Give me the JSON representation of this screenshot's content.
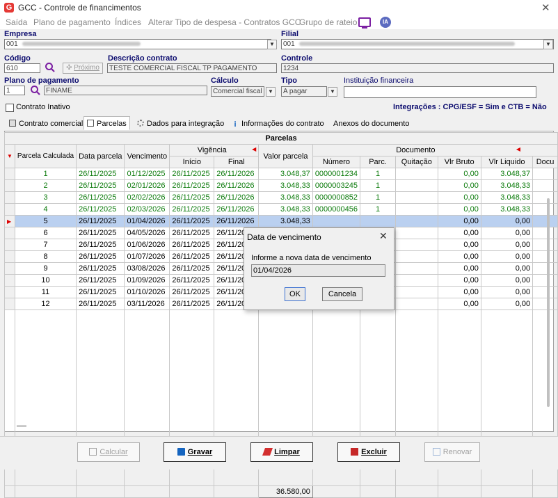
{
  "window": {
    "title": "GCC - Controle de financimentos",
    "close_label": "✕",
    "logo_letter": "G"
  },
  "menu": {
    "items": [
      "Saída",
      "Plano de pagamento",
      "Índices",
      "Alterar Tipo de despesa - Contratos GCC",
      "Grupo de rateio"
    ],
    "ia_label": "IA"
  },
  "form": {
    "empresa": {
      "label": "Empresa",
      "value": "001"
    },
    "filial": {
      "label": "Filial",
      "value": "001"
    },
    "codigo": {
      "label": "Código",
      "value": "610"
    },
    "proximo_label": "Próximo",
    "descricao": {
      "label": "Descrição contrato",
      "value": "TESTE COMERCIAL FISCAL TP PAGAMENTO"
    },
    "controle": {
      "label": "Controle",
      "value": "1234"
    },
    "plano": {
      "label": "Plano de pagamento",
      "code": "1",
      "name": "FINAME"
    },
    "calculo": {
      "label": "Cálculo",
      "value": "Comercial fiscal"
    },
    "tipo": {
      "label": "Tipo",
      "value": "A pagar"
    },
    "instituicao": {
      "label": "Instituição financeira",
      "value": ""
    },
    "inativo_label": "Contrato Inativo",
    "integracoes": "Integrações : CPG/ESF = Sim e CTB = Não"
  },
  "tabs": [
    "Contrato comercial",
    "Parcelas",
    "Dados para integração",
    "Informações do contrato",
    "Anexos do documento"
  ],
  "grid": {
    "caption": "Parcelas",
    "headers": {
      "parcela": "Parcela Calculada",
      "data_parcela": "Data parcela",
      "vencimento": "Vencimento",
      "vigencia": "Vigência",
      "inicio": "Início",
      "final": "Final",
      "valor": "Valor parcela",
      "documento": "Documento",
      "numero": "Número",
      "parc": "Parc.",
      "quitacao": "Quitação",
      "vlr_bruto": "Vlr Bruto",
      "vlr_liquido": "Vlr Liquido",
      "docu": "Docu"
    },
    "rows": [
      {
        "p": "1",
        "dp": "26/11/2025",
        "v": "01/12/2025",
        "i": "26/11/2025",
        "f": "26/11/2026",
        "val": "3.048,37",
        "num": "0000001234",
        "parc": "1",
        "q": "",
        "vb": "0,00",
        "vl": "3.048,37"
      },
      {
        "p": "2",
        "dp": "26/11/2025",
        "v": "02/01/2026",
        "i": "26/11/2025",
        "f": "26/11/2026",
        "val": "3.048,33",
        "num": "0000003245",
        "parc": "1",
        "q": "",
        "vb": "0,00",
        "vl": "3.048,33"
      },
      {
        "p": "3",
        "dp": "26/11/2025",
        "v": "02/02/2026",
        "i": "26/11/2025",
        "f": "26/11/2026",
        "val": "3.048,33",
        "num": "0000000852",
        "parc": "1",
        "q": "",
        "vb": "0,00",
        "vl": "3.048,33"
      },
      {
        "p": "4",
        "dp": "26/11/2025",
        "v": "02/03/2026",
        "i": "26/11/2025",
        "f": "26/11/2026",
        "val": "3.048,33",
        "num": "0000000456",
        "parc": "1",
        "q": "",
        "vb": "0,00",
        "vl": "3.048,33"
      },
      {
        "p": "5",
        "dp": "26/11/2025",
        "v": "01/04/2026",
        "i": "26/11/2025",
        "f": "26/11/2026",
        "val": "3.048,33",
        "num": "",
        "parc": "",
        "q": "",
        "vb": "0,00",
        "vl": "0,00"
      },
      {
        "p": "6",
        "dp": "26/11/2025",
        "v": "04/05/2026",
        "i": "26/11/2025",
        "f": "26/11/2026",
        "val": "",
        "num": "",
        "parc": "",
        "q": "",
        "vb": "0,00",
        "vl": "0,00"
      },
      {
        "p": "7",
        "dp": "26/11/2025",
        "v": "01/06/2026",
        "i": "26/11/2025",
        "f": "26/11/2026",
        "val": "",
        "num": "",
        "parc": "",
        "q": "",
        "vb": "0,00",
        "vl": "0,00"
      },
      {
        "p": "8",
        "dp": "26/11/2025",
        "v": "01/07/2026",
        "i": "26/11/2025",
        "f": "26/11/2026",
        "val": "",
        "num": "",
        "parc": "",
        "q": "",
        "vb": "0,00",
        "vl": "0,00"
      },
      {
        "p": "9",
        "dp": "26/11/2025",
        "v": "03/08/2026",
        "i": "26/11/2025",
        "f": "26/11/2026",
        "val": "",
        "num": "",
        "parc": "",
        "q": "",
        "vb": "0,00",
        "vl": "0,00"
      },
      {
        "p": "10",
        "dp": "26/11/2025",
        "v": "01/09/2026",
        "i": "26/11/2025",
        "f": "26/11/2026",
        "val": "",
        "num": "",
        "parc": "",
        "q": "",
        "vb": "0,00",
        "vl": "0,00"
      },
      {
        "p": "11",
        "dp": "26/11/2025",
        "v": "01/10/2026",
        "i": "26/11/2025",
        "f": "26/11/2026",
        "val": "",
        "num": "",
        "parc": "",
        "q": "",
        "vb": "0,00",
        "vl": "0,00"
      },
      {
        "p": "12",
        "dp": "26/11/2025",
        "v": "03/11/2026",
        "i": "26/11/2025",
        "f": "26/11/2026",
        "val": "",
        "num": "",
        "parc": "",
        "q": "",
        "vb": "0,00",
        "vl": "0,00"
      }
    ],
    "green_rows": 4,
    "selected_row": 5,
    "total": "36.580,00"
  },
  "dialog": {
    "title": "Data de vencimento",
    "label": "Informe a nova data de vencimento",
    "value": "01/04/2026",
    "ok": "OK",
    "cancel": "Cancela"
  },
  "actions": {
    "calcular": "Calcular",
    "gravar": "Gravar",
    "limpar": "Limpar",
    "excluir": "Excluir",
    "renovar": "Renovar"
  },
  "colors": {
    "label_blue": "#0b0b6e",
    "green_row": "#0a7a0a",
    "selected_row": "#bad0f0",
    "brand_red": "#e53935",
    "ia_purple": "#7b1fa2"
  }
}
